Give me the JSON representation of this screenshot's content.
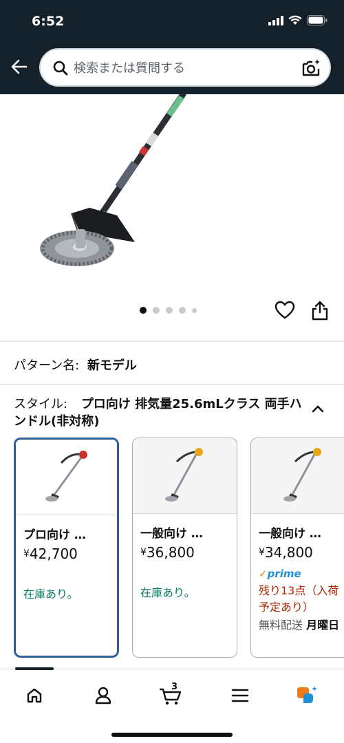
{
  "status_bar": {
    "time": "6:52"
  },
  "search": {
    "placeholder": "検索または質問する"
  },
  "carousel": {
    "total_images": 5,
    "active_index": 0
  },
  "pattern": {
    "label": "パターン名:",
    "value": "新モデル"
  },
  "style": {
    "label": "スタイル:",
    "value": "プロ向け 排気量25.6mLクラス 両手ハンドル(非対称)"
  },
  "cards": [
    {
      "title": "プロ向け …",
      "currency": "¥",
      "price": "42,700",
      "stock": "在庫あり。",
      "selected": true
    },
    {
      "title": "一般向け …",
      "currency": "¥",
      "price": "36,800",
      "stock": "在庫あり。",
      "selected": false
    },
    {
      "title": "一般向け …",
      "currency": "¥",
      "price": "34,800",
      "prime": "prime",
      "stock": "残り13点（入荷予定あり）",
      "delivery_label": "無料配送",
      "delivery_date": "月曜日",
      "selected": false
    }
  ],
  "bottom_nav": {
    "cart_count": "3"
  },
  "colors": {
    "header_bg": "#15212a",
    "in_stock": "#067d62",
    "low_stock": "#b12704",
    "selected_border": "#2d5f96",
    "prime_blue": "#1f8fd6"
  },
  "icons": [
    "back-arrow-icon",
    "search-icon",
    "camera-icon",
    "heart-icon",
    "share-icon",
    "chevron-up-icon",
    "home-icon",
    "account-icon",
    "cart-icon",
    "menu-icon",
    "rufus-icon"
  ]
}
